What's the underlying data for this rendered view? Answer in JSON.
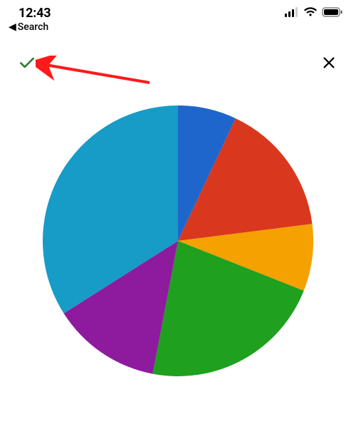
{
  "status": {
    "time": "12:43"
  },
  "back": {
    "label": "Search"
  },
  "colors": {
    "check": "#2e7d32",
    "close": "#000000",
    "arrow": "#ff1a1a"
  },
  "chart_data": {
    "type": "pie",
    "title": "",
    "series": [
      {
        "name": "slice-blue",
        "value": 7,
        "color": "#1f66cc"
      },
      {
        "name": "slice-red",
        "value": 16,
        "color": "#d9381e"
      },
      {
        "name": "slice-orange",
        "value": 8,
        "color": "#f5a100"
      },
      {
        "name": "slice-green",
        "value": 22,
        "color": "#1fa01f"
      },
      {
        "name": "slice-purple",
        "value": 13,
        "color": "#8e1b9e"
      },
      {
        "name": "slice-lightblue",
        "value": 34,
        "color": "#179bc7"
      }
    ]
  }
}
